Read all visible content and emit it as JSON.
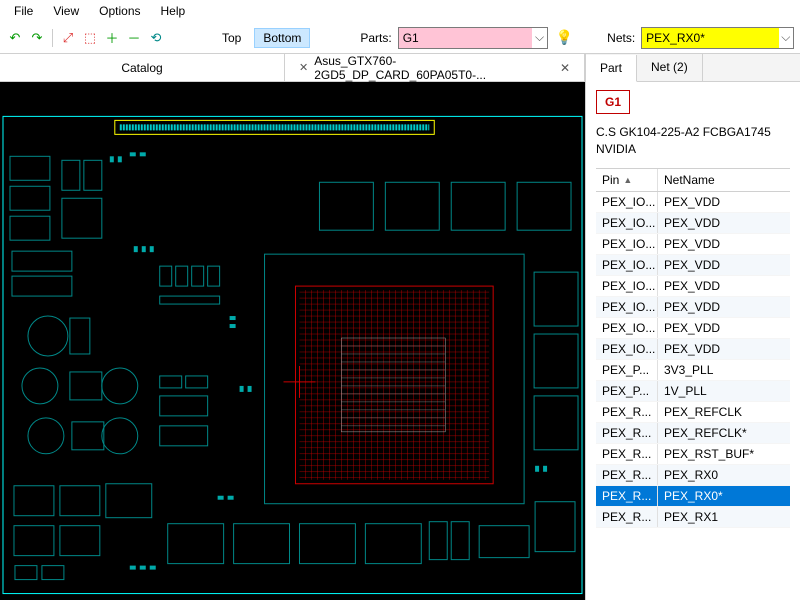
{
  "menu": {
    "file": "File",
    "view": "View",
    "options": "Options",
    "help": "Help"
  },
  "toolbar": {
    "top_label": "Top",
    "bottom_label": "Bottom",
    "parts_label": "Parts:",
    "parts_value": "G1",
    "nets_label": "Nets:",
    "nets_value": "PEX_RX0*"
  },
  "tabs": {
    "catalog": "Catalog",
    "file": "Asus_GTX760-2GD5_DP_CARD_60PA05T0-..."
  },
  "rtabs": {
    "part": "Part",
    "net": "Net (2)"
  },
  "part": {
    "ref": "G1",
    "desc1": "C.S GK104-225-A2 FCBGA1745",
    "desc2": "NVIDIA"
  },
  "pin_header": {
    "pin": "Pin",
    "net": "NetName"
  },
  "pins": [
    {
      "pin": "PEX_IO...",
      "net": "PEX_VDD"
    },
    {
      "pin": "PEX_IO...",
      "net": "PEX_VDD"
    },
    {
      "pin": "PEX_IO...",
      "net": "PEX_VDD"
    },
    {
      "pin": "PEX_IO...",
      "net": "PEX_VDD"
    },
    {
      "pin": "PEX_IO...",
      "net": "PEX_VDD"
    },
    {
      "pin": "PEX_IO...",
      "net": "PEX_VDD"
    },
    {
      "pin": "PEX_IO...",
      "net": "PEX_VDD"
    },
    {
      "pin": "PEX_IO...",
      "net": "PEX_VDD"
    },
    {
      "pin": "PEX_P...",
      "net": "3V3_PLL"
    },
    {
      "pin": "PEX_P...",
      "net": "1V_PLL"
    },
    {
      "pin": "PEX_R...",
      "net": "PEX_REFCLK"
    },
    {
      "pin": "PEX_R...",
      "net": "PEX_REFCLK*"
    },
    {
      "pin": "PEX_R...",
      "net": "PEX_RST_BUF*"
    },
    {
      "pin": "PEX_R...",
      "net": "PEX_RX0"
    },
    {
      "pin": "PEX_R...",
      "net": "PEX_RX0*"
    },
    {
      "pin": "PEX_R...",
      "net": "PEX_RX1"
    }
  ],
  "selected_pin_index": 14
}
